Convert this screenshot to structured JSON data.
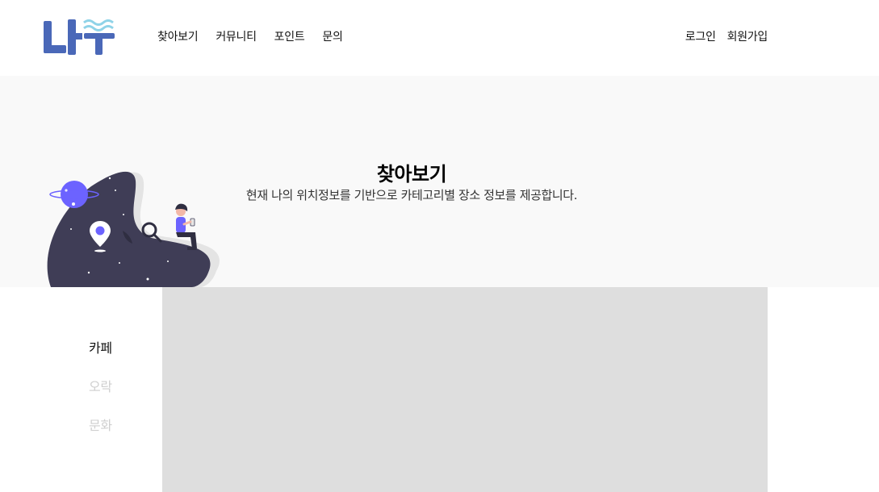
{
  "logo": {
    "text": "나루",
    "brand_color": "#4a68b8",
    "wave_color": "#8fd3e8"
  },
  "nav": {
    "items": [
      {
        "label": "찾아보기"
      },
      {
        "label": "커뮤니티"
      },
      {
        "label": "포인트"
      },
      {
        "label": "문의"
      }
    ]
  },
  "auth": {
    "login": "로그인",
    "signup": "회원가입"
  },
  "hero": {
    "title": "찾아보기",
    "subtitle": "현재 나의 위치정보를 기반으로 카테고리별 장소 정보를 제공합니다."
  },
  "sidebar": {
    "items": [
      {
        "label": "카페",
        "active": true
      },
      {
        "label": "오락",
        "active": false
      },
      {
        "label": "문화",
        "active": false
      }
    ]
  },
  "colors": {
    "hero_bg": "#f9f9f9",
    "map_bg": "#dedede",
    "illustration_dark": "#3f3d56",
    "illustration_accent": "#6c63ff"
  }
}
